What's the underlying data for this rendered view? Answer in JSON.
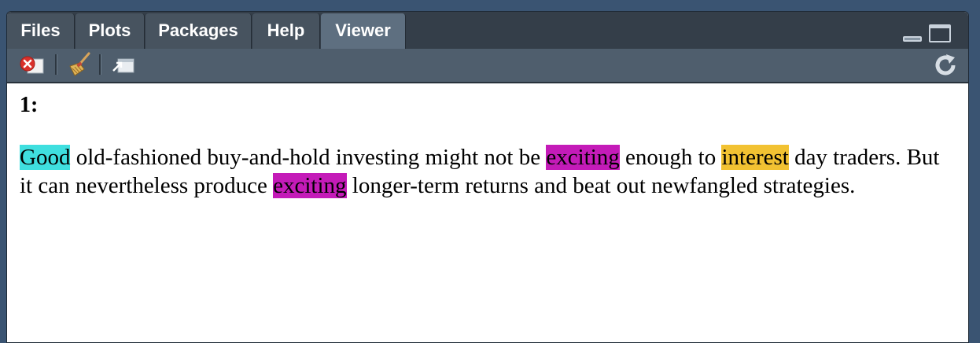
{
  "tabs": [
    {
      "label": "Files",
      "active": false
    },
    {
      "label": "Plots",
      "active": false
    },
    {
      "label": "Packages",
      "active": false
    },
    {
      "label": "Help",
      "active": false
    },
    {
      "label": "Viewer",
      "active": true
    }
  ],
  "toolbar": {
    "icons": [
      "clear-viewer-icon",
      "broom-icon",
      "export-icon",
      "refresh-icon"
    ]
  },
  "viewer": {
    "heading": "1:",
    "segments": [
      {
        "text": "Good",
        "highlight": "#3fdfdf"
      },
      {
        "text": " old-fashioned buy-and-hold investing might not be ",
        "highlight": null
      },
      {
        "text": "exciting",
        "highlight": "#c41bb8"
      },
      {
        "text": " enough to ",
        "highlight": null
      },
      {
        "text": "interest",
        "highlight": "#f2c232"
      },
      {
        "text": " day traders. But it can nevertheless produce ",
        "highlight": null
      },
      {
        "text": "exciting",
        "highlight": "#c41bb8"
      },
      {
        "text": " longer-term returns and beat out newfangled strategies.",
        "highlight": null
      }
    ]
  },
  "colors": {
    "background": "#3a5472",
    "tab_bar": "#343e49",
    "tab": "#47535f",
    "tab_active": "#5e6f80",
    "toolbar": "#4f5e6d"
  }
}
